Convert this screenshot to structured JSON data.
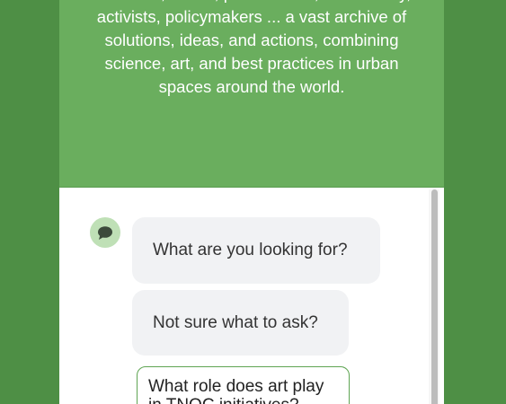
{
  "intro": {
    "text": "scientists, artists, practitioners, civil society, activists, policymakers ... a vast archive of solutions, ideas, and actions, combining science, art, and best practices in urban spaces around the world."
  },
  "chat": {
    "avatar_icon": "speech-bubble-icon",
    "messages": [
      "What are you looking for?",
      "Not sure what to ask?"
    ],
    "suggestions": [
      "What role does art play in TNOC initiatives?"
    ]
  },
  "colors": {
    "page_background": "#4e8f45",
    "intro_background": "#6aae5e",
    "accent": "#5fa553",
    "bubble_background": "#f1f2f4",
    "avatar_background": "#bfe0b6"
  }
}
